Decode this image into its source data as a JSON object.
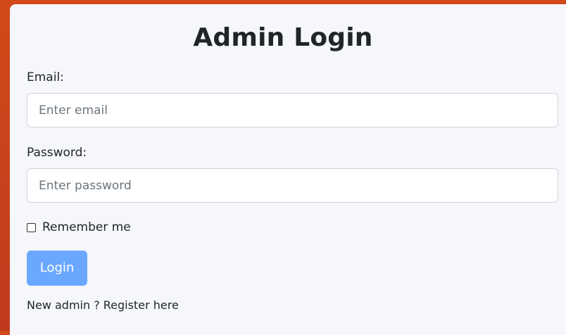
{
  "page": {
    "title": "Admin Login"
  },
  "form": {
    "email": {
      "label": "Email:",
      "placeholder": "Enter email",
      "value": ""
    },
    "password": {
      "label": "Password:",
      "placeholder": "Enter password",
      "value": ""
    },
    "remember": {
      "label": "Remember me",
      "checked": false
    },
    "login_button": "Login"
  },
  "footer": {
    "prefix": "New admin ? ",
    "link_text": "Register here"
  },
  "colors": {
    "background": "#c9431f",
    "card": "#f6f7fb",
    "button": "#6aa7ff",
    "text": "#212529"
  }
}
